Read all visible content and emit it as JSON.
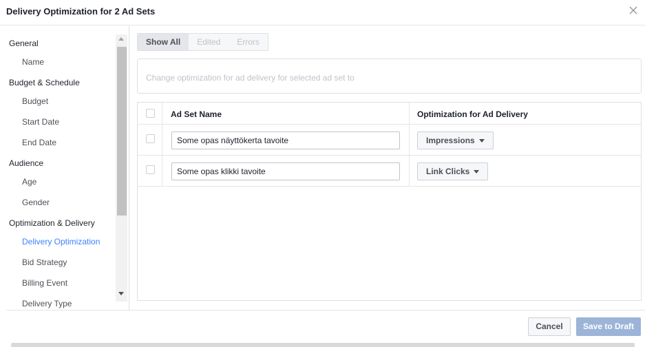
{
  "dialog": {
    "title": "Delivery Optimization for 2 Ad Sets",
    "close_icon": "close-icon"
  },
  "sidebar": {
    "sections": [
      {
        "label": "General",
        "items": [
          "Name"
        ]
      },
      {
        "label": "Budget & Schedule",
        "items": [
          "Budget",
          "Start Date",
          "End Date"
        ]
      },
      {
        "label": "Audience",
        "items": [
          "Age",
          "Gender"
        ]
      },
      {
        "label": "Optimization & Delivery",
        "items": [
          "Delivery Optimization",
          "Bid Strategy",
          "Billing Event"
        ]
      }
    ],
    "active_item": "Delivery Optimization",
    "truncated_item": "Delivery Type"
  },
  "filters": {
    "show_all": "Show All",
    "edited": "Edited",
    "errors": "Errors",
    "active": "Show All"
  },
  "bulk": {
    "label": "Change optimization for ad delivery for selected ad set to"
  },
  "table": {
    "columns": [
      "Ad Set Name",
      "Optimization for Ad Delivery"
    ],
    "rows": [
      {
        "name": "Some opas näyttökerta tavoite",
        "optimization": "Impressions"
      },
      {
        "name": "Some opas klikki tavoite",
        "optimization": "Link Clicks"
      }
    ]
  },
  "footer": {
    "cancel": "Cancel",
    "save": "Save to Draft"
  },
  "colors": {
    "accent": "#4080ff",
    "save_disabled": "#9cb4d8",
    "border": "#dddfe2"
  }
}
